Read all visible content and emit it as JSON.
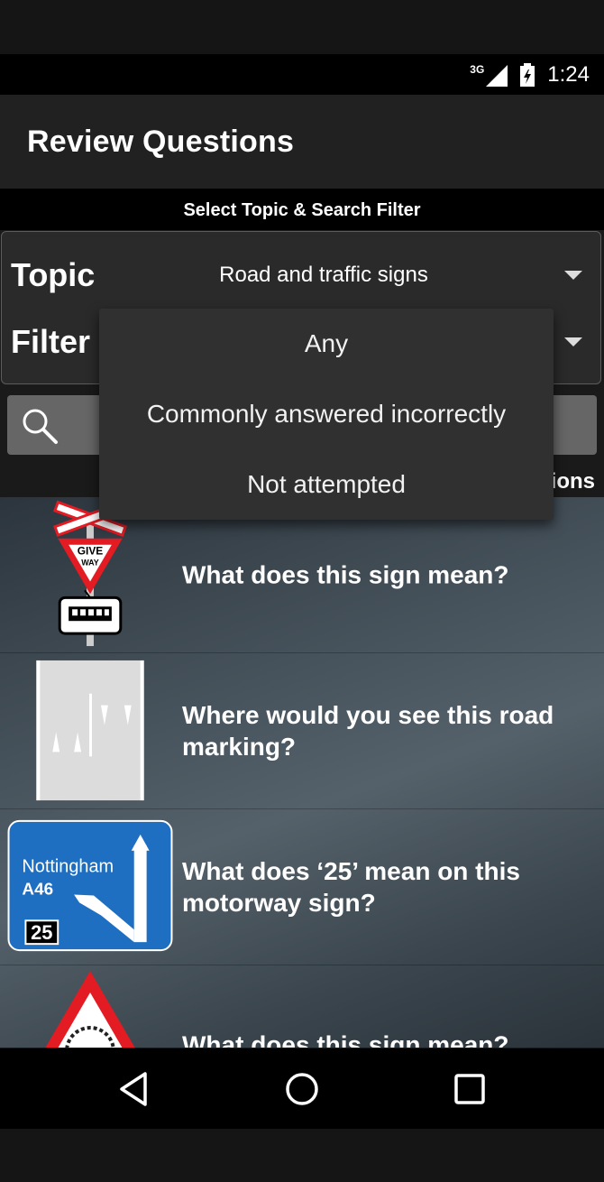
{
  "status_bar": {
    "network_label": "3G",
    "time": "1:24"
  },
  "app_bar": {
    "title": "Review Questions"
  },
  "subheader": {
    "text": "Select Topic & Search Filter"
  },
  "filters": {
    "topic_label": "Topic",
    "topic_value": "Road and traffic signs",
    "filter_label": "Filter",
    "filter_value": ""
  },
  "search": {
    "placeholder": ""
  },
  "count_text": "ions",
  "dropdown": {
    "options": [
      "Any",
      "Commonly answered incorrectly",
      "Not attempted"
    ]
  },
  "questions": [
    {
      "text": "What does this sign mean?",
      "sign": "give-way-tram-crossing",
      "sign_text": "GIVE WAY"
    },
    {
      "text": "Where would you see this road marking?",
      "sign": "road-marking"
    },
    {
      "text": "What does ‘25’ mean on this motorway sign?",
      "sign": "motorway-exit",
      "sign_lines": [
        "Nottingham",
        "A46",
        "25"
      ]
    },
    {
      "text": "What does this sign mean?",
      "sign": "warning-triangle"
    }
  ],
  "colors": {
    "app_bar": "#212121",
    "panel": "#2a2a2a",
    "dropdown": "#303030",
    "motorway_blue": "#1e6fc2",
    "sign_red": "#e31b23"
  }
}
